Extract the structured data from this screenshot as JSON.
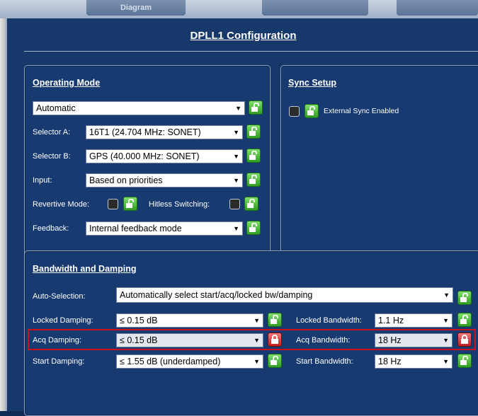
{
  "top_tabs": [
    "Diagram",
    "",
    ""
  ],
  "title": "DPLL1 Configuration",
  "operating_mode": {
    "title": "Operating Mode",
    "mode_value": "Automatic",
    "selector_a_label": "Selector A:",
    "selector_a_value": "16T1 (24.704 MHz: SONET)",
    "selector_b_label": "Selector B:",
    "selector_b_value": "GPS (40.000 MHz: SONET)",
    "input_label": "Input:",
    "input_value": "Based on priorities",
    "revertive_label": "Revertive Mode:",
    "hitless_label": "Hitless Switching:",
    "feedback_label": "Feedback:",
    "feedback_value": "Internal feedback mode"
  },
  "sync_setup": {
    "title": "Sync Setup",
    "external_label": "External Sync Enabled"
  },
  "bandwidth": {
    "title": "Bandwidth and Damping",
    "auto_label": "Auto-Selection:",
    "auto_value": "Automatically select start/acq/locked bw/damping",
    "locked_damping_label": "Locked Damping:",
    "locked_damping_value": "≤ 0.15 dB",
    "locked_bw_label": "Locked Bandwidth:",
    "locked_bw_value": "1.1 Hz",
    "acq_damping_label": "Acq Damping:",
    "acq_damping_value": "≤ 0.15 dB",
    "acq_bw_label": "Acq Bandwidth:",
    "acq_bw_value": "18 Hz",
    "start_damping_label": "Start Damping:",
    "start_damping_value": "≤ 1.55 dB (underdamped)",
    "start_bw_label": "Start Bandwidth:",
    "start_bw_value": "18 Hz"
  },
  "icons": {
    "dropdown_arrow": "▼"
  },
  "colors": {
    "background": "#16386b",
    "lock_unlocked": "#2f9e22",
    "lock_locked": "#c21e1e",
    "highlight": "#d0101e"
  }
}
